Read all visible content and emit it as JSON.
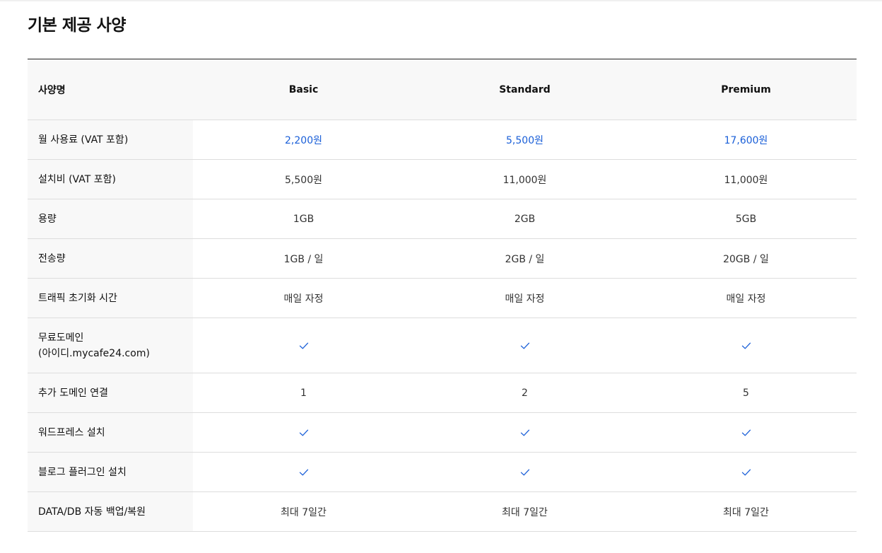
{
  "page": {
    "title": "기본 제공 사양"
  },
  "table": {
    "header": {
      "label": "사양명",
      "plans": [
        "Basic",
        "Standard",
        "Premium"
      ]
    },
    "rows": [
      {
        "label": [
          "월 사용료 (VAT 포함)"
        ],
        "type": "price",
        "values": [
          "2,200원",
          "5,500원",
          "17,600원"
        ]
      },
      {
        "label": [
          "설치비 (VAT 포함)"
        ],
        "type": "text",
        "values": [
          "5,500원",
          "11,000원",
          "11,000원"
        ]
      },
      {
        "label": [
          "용량"
        ],
        "type": "text",
        "values": [
          "1GB",
          "2GB",
          "5GB"
        ]
      },
      {
        "label": [
          "전송량"
        ],
        "type": "text",
        "values": [
          "1GB / 일",
          "2GB / 일",
          "20GB / 일"
        ]
      },
      {
        "label": [
          "트래픽 초기화 시간"
        ],
        "type": "text",
        "values": [
          "매일 자정",
          "매일 자정",
          "매일 자정"
        ]
      },
      {
        "label": [
          "무료도메인",
          "(아이디.mycafe24.com)"
        ],
        "type": "check",
        "values": [
          true,
          true,
          true
        ]
      },
      {
        "label": [
          "추가 도메인 연결"
        ],
        "type": "text",
        "values": [
          "1",
          "2",
          "5"
        ]
      },
      {
        "label": [
          "워드프레스 설치"
        ],
        "type": "check",
        "values": [
          true,
          true,
          true
        ]
      },
      {
        "label": [
          "블로그 플러그인 설치"
        ],
        "type": "check",
        "values": [
          true,
          true,
          true
        ]
      },
      {
        "label": [
          "DATA/DB 자동 백업/복원"
        ],
        "type": "text",
        "values": [
          "최대 7일간",
          "최대 7일간",
          "최대 7일간"
        ]
      }
    ]
  },
  "colors": {
    "accent": "#1a5fd8",
    "header_bg": "#f8f8f8",
    "border": "#dddddd"
  },
  "icons": {
    "included": "check-icon"
  }
}
